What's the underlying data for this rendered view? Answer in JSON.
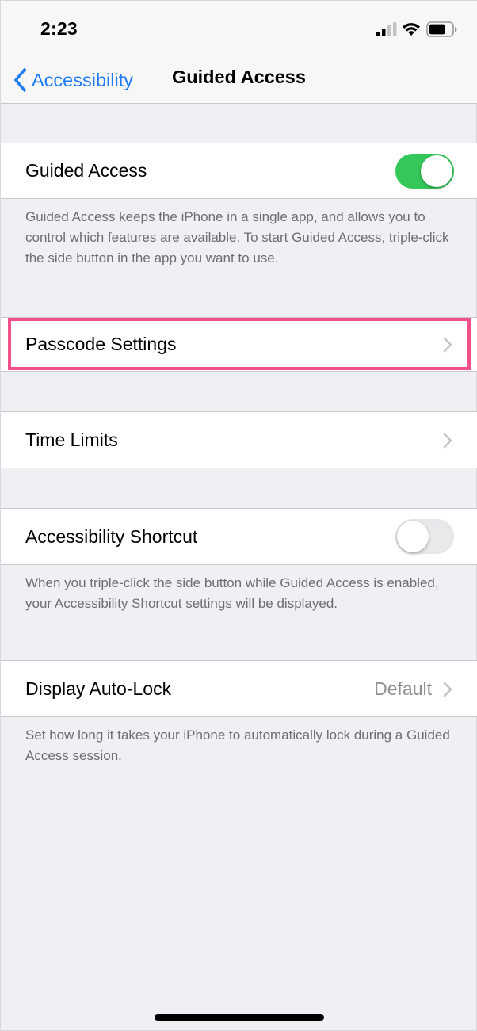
{
  "status_bar": {
    "time": "2:23"
  },
  "nav": {
    "back_label": "Accessibility",
    "title": "Guided Access"
  },
  "guided_access": {
    "label": "Guided Access",
    "toggle_on": true,
    "footer": "Guided Access keeps the iPhone in a single app, and allows you to control which features are available. To start Guided Access, triple-click the side button in the app you want to use."
  },
  "passcode_settings": {
    "label": "Passcode Settings"
  },
  "time_limits": {
    "label": "Time Limits"
  },
  "accessibility_shortcut": {
    "label": "Accessibility Shortcut",
    "toggle_on": false,
    "footer": "When you triple-click the side button while Guided Access is enabled, your Accessibility Shortcut settings will be displayed."
  },
  "display_auto_lock": {
    "label": "Display Auto-Lock",
    "value": "Default",
    "footer": "Set how long it takes your iPhone to automatically lock during a Guided Access session."
  },
  "colors": {
    "accent": "#1f7bf6",
    "toggle_on": "#35c759",
    "highlight": "#f0518b",
    "background": "#efeff4"
  },
  "icons": {
    "signal": "signal-bars-icon",
    "wifi": "wifi-icon",
    "battery": "battery-icon",
    "back": "chevron-left-icon",
    "disclosure": "chevron-right-icon"
  }
}
